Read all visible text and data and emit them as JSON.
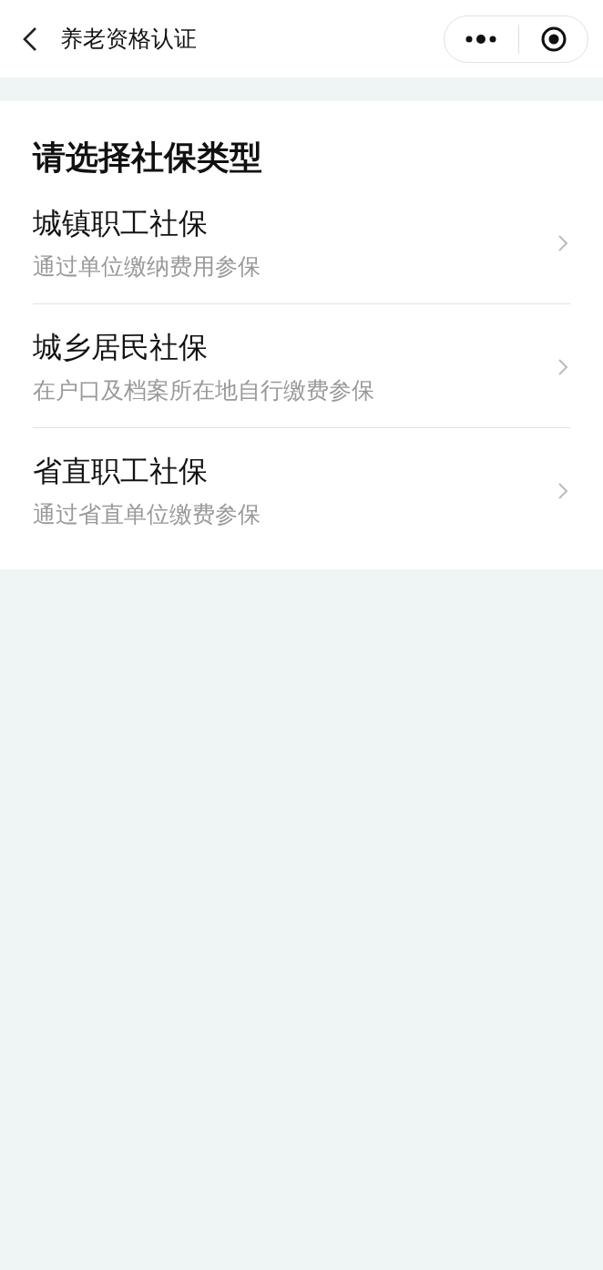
{
  "nav": {
    "title": "养老资格认证"
  },
  "heading": "请选择社保类型",
  "options": [
    {
      "title": "城镇职工社保",
      "subtitle": "通过单位缴纳费用参保"
    },
    {
      "title": "城乡居民社保",
      "subtitle": "在户口及档案所在地自行缴费参保"
    },
    {
      "title": "省直职工社保",
      "subtitle": "通过省直单位缴费参保"
    }
  ]
}
